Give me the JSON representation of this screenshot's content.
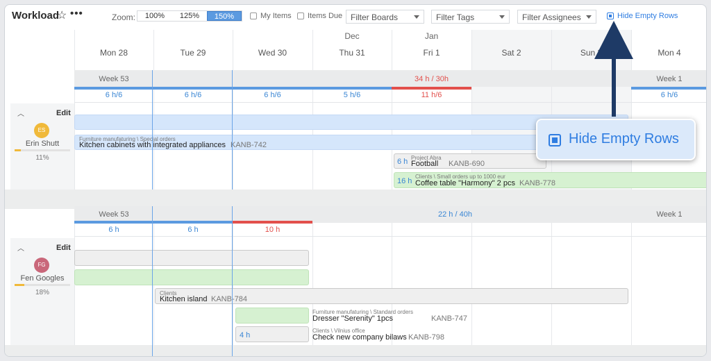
{
  "header": {
    "title": "Workload",
    "zoom_label": "Zoom:",
    "zoom_options": [
      "100%",
      "125%",
      "150%"
    ],
    "zoom_selected": "150%",
    "my_items": "My Items",
    "items_due": "Items Due",
    "filter_boards": "Filter Boards",
    "filter_tags": "Filter Tags",
    "filter_assignees": "Filter Assignees",
    "hide_empty_rows": "Hide Empty Rows"
  },
  "calendar": {
    "months": [
      "Dec",
      "Jan"
    ],
    "days": [
      "Mon 28",
      "Tue 29",
      "Wed 30",
      "Thu 31",
      "Fri 1",
      "Sat 2",
      "Sun 3",
      "Mon 4"
    ]
  },
  "users": [
    {
      "initials": "ES",
      "name": "Erin Shutt",
      "percent": "11%",
      "progress": 0.11,
      "color": "#f0b93a",
      "edit": "Edit",
      "week_left": "Week 53",
      "week_total": "34 h / 30h",
      "week_right": "Week 1",
      "day_hours": [
        "6 h/6",
        "6 h/6",
        "6 h/6",
        "5 h/6",
        "11 h/6",
        "6 h/6"
      ],
      "tasks": [
        {
          "meta": "Furniture manufaturing \\ Special orders",
          "name": "Kitchen cabinets with integrated appliances",
          "key": "KANB-742"
        },
        {
          "hours": "6 h",
          "meta": "Project Abra",
          "name": "Football",
          "key": "KANB-690"
        },
        {
          "hours": "16 h",
          "meta": "Clients \\ Small orders up to 1000 eur",
          "name": "Coffee table \"Harmony\" 2 pcs",
          "key": "KANB-778"
        }
      ]
    },
    {
      "initials": "FG",
      "name": "Fen Googles",
      "percent": "18%",
      "progress": 0.18,
      "color": "#c9677a",
      "edit": "Edit",
      "week_left": "Week 53",
      "week_total": "22 h / 40h",
      "week_right": "Week 1",
      "day_hours": [
        "6 h",
        "6 h",
        "10 h"
      ],
      "tasks": [
        {
          "meta": "Clients",
          "name": "Kitchen island",
          "key": "KANB-784"
        },
        {
          "meta": "Furniture manufaturing \\ Standard orders",
          "name": "Dresser \"Serenity\" 1pcs",
          "key": "KANB-747"
        },
        {
          "hours": "4 h",
          "meta": "Clients \\ Vilnius office",
          "name": "Check new company bilaws",
          "key": "KANB-798"
        }
      ]
    }
  ],
  "callout": {
    "label": "Hide Empty Rows"
  }
}
